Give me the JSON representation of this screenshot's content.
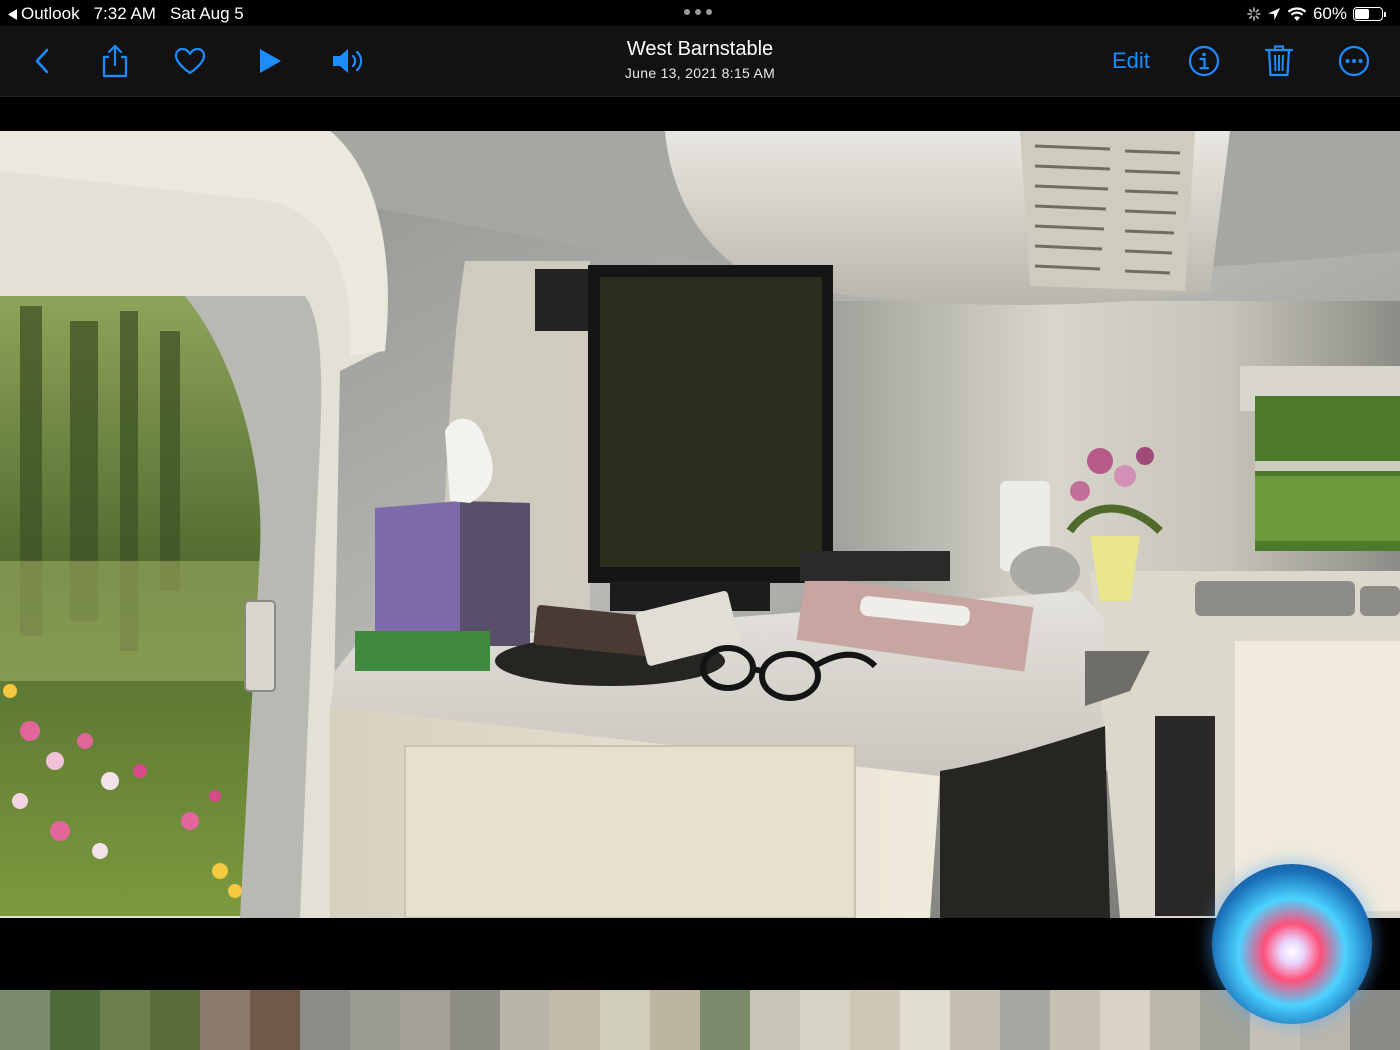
{
  "status_bar": {
    "back_app": "Outlook",
    "time": "7:32 AM",
    "date": "Sat Aug 5",
    "battery": "60%",
    "battery_level": 0.6
  },
  "toolbar": {
    "title": "West Barnstable",
    "subtitle": "June 13, 2021  8:15 AM",
    "edit_label": "Edit",
    "accent": "#1c8cff",
    "icons": [
      "back-icon",
      "share-icon",
      "heart-icon",
      "play-icon",
      "speaker-icon",
      "info-icon",
      "trash-icon",
      "more-icon"
    ]
  },
  "photo": {
    "description_icon": "photo-image"
  },
  "filmstrip": {
    "thumbnails": [
      {
        "color": "#7a8a6a"
      },
      {
        "color": "#4f6a3a"
      },
      {
        "color": "#6b7f4a"
      },
      {
        "color": "#5a6e3c"
      },
      {
        "color": "#8a7a6a"
      },
      {
        "color": "#6f5a4a"
      },
      {
        "color": "#8c8c88"
      },
      {
        "color": "#9a9a92"
      },
      {
        "color": "#a3a09a"
      },
      {
        "color": "#8e8e86"
      },
      {
        "color": "#b8b4a8"
      },
      {
        "color": "#c2bca8"
      },
      {
        "color": "#d0ccbc"
      },
      {
        "color": "#bdb5a0"
      },
      {
        "color": "#7b8a6a"
      },
      {
        "color": "#c8c4b6"
      },
      {
        "color": "#d6d2c4"
      },
      {
        "color": "#cfc8b8"
      },
      {
        "color": "#e0dcd0"
      },
      {
        "color": "#c4beb0"
      },
      {
        "color": "#a8a6a0"
      },
      {
        "color": "#c7c1b3"
      },
      {
        "color": "#d8d2c6"
      },
      {
        "color": "#bbb6aa"
      },
      {
        "color": "#9fa39a"
      },
      {
        "color": "#c6c1b6"
      },
      {
        "color": "#bab6ae"
      },
      {
        "color": "#8b8b86"
      }
    ]
  }
}
